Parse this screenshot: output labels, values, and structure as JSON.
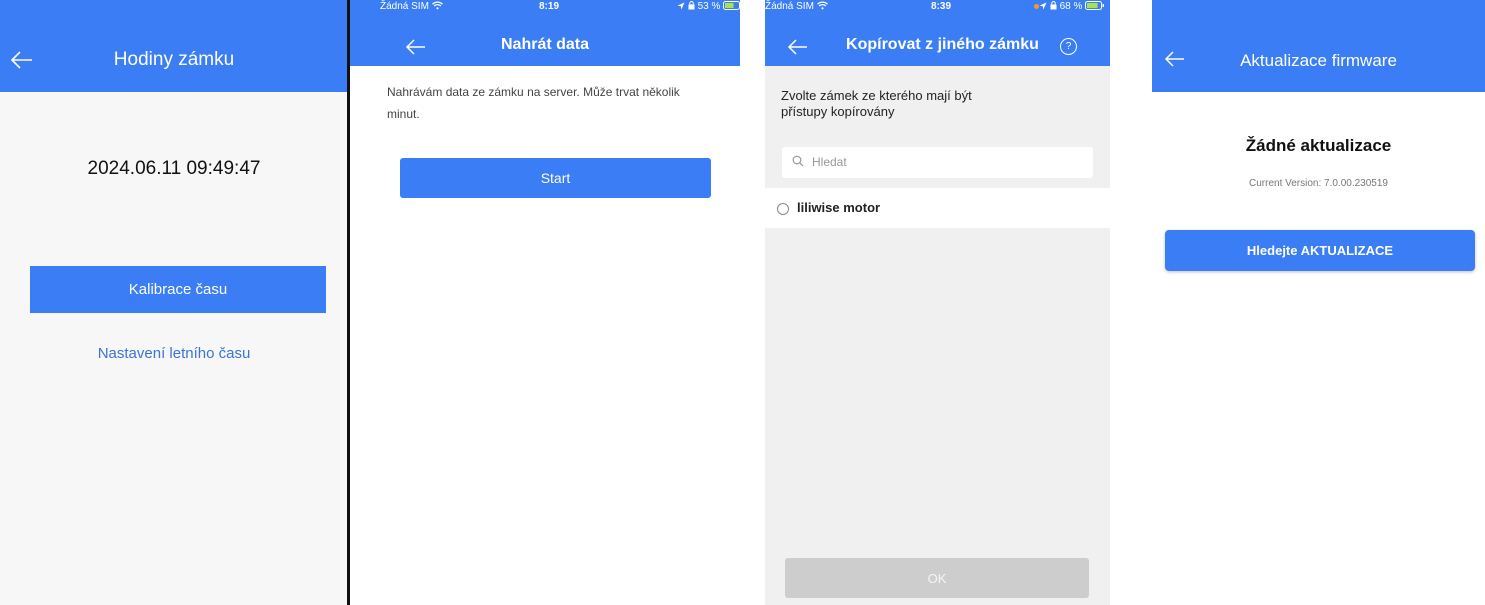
{
  "screens": [
    {
      "title": "Hodiny zámku",
      "clock": "2024.06.11 09:49:47",
      "calibrate_label": "Kalibrace času",
      "dst_link": "Nastavení letního času"
    },
    {
      "status": {
        "carrier": "Žádná SIM",
        "time": "8:19",
        "battery": "53 %"
      },
      "title": "Nahrát data",
      "description": "Nahrávám data ze zámku na server. Může trvat několik minut.",
      "start_label": "Start"
    },
    {
      "status": {
        "carrier": "Žádná SIM",
        "time": "8:39",
        "battery": "68 %"
      },
      "title": "Kopírovat z jiného zámku",
      "help_glyph": "?",
      "prompt": "Zvolte zámek ze kterého mají být přístupy kopírovány",
      "search_placeholder": "Hledat",
      "items": [
        {
          "label": "liliwise motor"
        }
      ],
      "ok_label": "OK"
    },
    {
      "title": "Aktualizace firmware",
      "no_updates": "Žádné aktualizace",
      "version": "Current Version: 7.0.00.230519",
      "check_label": "Hledejte AKTUALIZACE"
    }
  ],
  "colors": {
    "accent": "#3b7df4",
    "link": "#3a74d8",
    "disabled": "#cdcdcd"
  },
  "icons": [
    "arrow-left-icon",
    "help-circle-icon",
    "search-icon",
    "wifi-icon",
    "location-icon",
    "battery-icon"
  ]
}
